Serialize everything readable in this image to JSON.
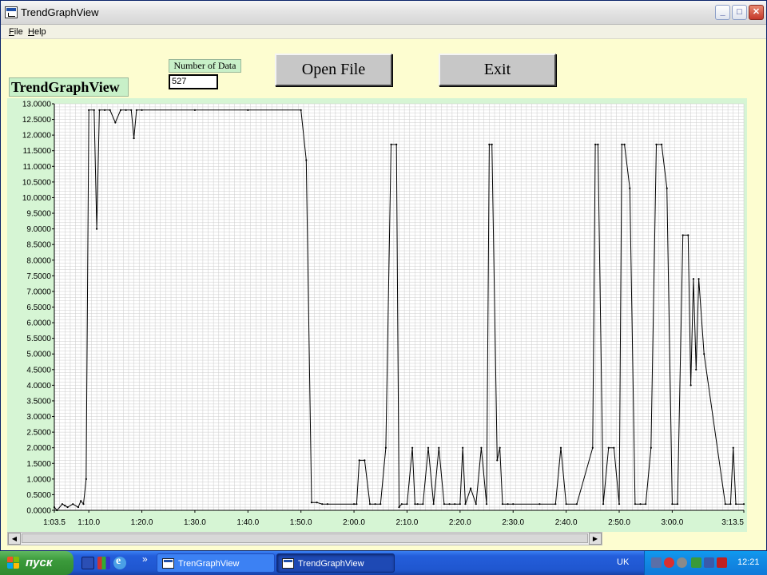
{
  "window": {
    "title": "TrendGraphView"
  },
  "menu": {
    "file": "File",
    "help": "Help"
  },
  "controls": {
    "number_of_data_label": "Number of Data",
    "number_of_data_value": "527",
    "open_file_label": "Open File",
    "exit_label": "Exit"
  },
  "chart_title": "TrendGraphView",
  "chart_data": {
    "type": "line",
    "title": "TrendGraphView",
    "xlabel": "",
    "ylabel": "",
    "ylim": [
      0,
      13
    ],
    "xlim": [
      "1:03.5",
      "3:13.5"
    ],
    "x_ticks": [
      "1:03.5",
      "1:10.0",
      "1:20.0",
      "1:30.0",
      "1:40.0",
      "1:50.0",
      "2:00.0",
      "2:10.0",
      "2:20.0",
      "2:30.0",
      "2:40.0",
      "2:50.0",
      "3:00.0",
      "3:13.5"
    ],
    "y_ticks": [
      "0.0000",
      "0.5000",
      "1.0000",
      "1.5000",
      "2.0000",
      "2.5000",
      "3.0000",
      "3.5000",
      "4.0000",
      "4.5000",
      "5.0000",
      "5.5000",
      "6.0000",
      "6.5000",
      "7.0000",
      "7.5000",
      "8.0000",
      "8.5000",
      "9.0000",
      "9.5000",
      "10.0000",
      "10.5000",
      "11.0000",
      "11.5000",
      "12.0000",
      "12.5000",
      "13.0000"
    ],
    "grid": true,
    "series": [
      {
        "x": [
          "1:03.5",
          "1:04.0",
          "1:05.0",
          "1:05.5",
          "1:06.0",
          "1:07.0",
          "1:08.0",
          "1:08.5",
          "1:09.0",
          "1:09.5",
          "1:10.0",
          "1:11.0",
          "1:11.5",
          "1:12.0",
          "1:13.0",
          "1:14.0",
          "1:15.0",
          "1:16.0",
          "1:17.0",
          "1:18.0",
          "1:18.5",
          "1:19.0",
          "1:20.0",
          "1:30.0",
          "1:40.0",
          "1:50.0",
          "1:51.0",
          "1:52.0",
          "1:53.0",
          "1:54.0",
          "1:55.0",
          "2:00.0",
          "2:00.5",
          "2:01.0",
          "2:02.0",
          "2:03.0",
          "2:04.0",
          "2:05.0",
          "2:06.0",
          "2:07.0",
          "2:08.0",
          "2:08.5",
          "2:09.0",
          "2:10.0",
          "2:11.0",
          "2:11.5",
          "2:12.0",
          "2:13.0",
          "2:14.0",
          "2:15.0",
          "2:16.0",
          "2:17.0",
          "2:18.0",
          "2:19.0",
          "2:20.0",
          "2:20.5",
          "2:21.0",
          "2:22.0",
          "2:23.0",
          "2:24.0",
          "2:25.0",
          "2:25.5",
          "2:26.0",
          "2:27.0",
          "2:27.5",
          "2:28.0",
          "2:29.0",
          "2:30.0",
          "2:35.0",
          "2:38.0",
          "2:39.0",
          "2:40.0",
          "2:42.0",
          "2:45.0",
          "2:45.5",
          "2:46.0",
          "2:47.0",
          "2:48.0",
          "2:49.0",
          "2:50.0",
          "2:50.5",
          "2:51.0",
          "2:52.0",
          "2:53.0",
          "2:54.0",
          "2:55.0",
          "2:56.0",
          "2:57.0",
          "2:58.0",
          "2:59.0",
          "3:00.0",
          "3:01.0",
          "3:02.0",
          "3:03.0",
          "3:03.5",
          "3:04.0",
          "3:04.5",
          "3:05.0",
          "3:06.0",
          "3:10.0",
          "3:11.0",
          "3:11.5",
          "3:12.0",
          "3:13.5"
        ],
        "values": [
          0.1,
          0.0,
          0.2,
          0.15,
          0.1,
          0.2,
          0.1,
          0.3,
          0.2,
          1.0,
          12.8,
          12.8,
          9.0,
          12.8,
          12.8,
          12.8,
          12.4,
          12.8,
          12.8,
          12.8,
          11.9,
          12.8,
          12.8,
          12.8,
          12.8,
          12.8,
          11.2,
          0.25,
          0.25,
          0.2,
          0.2,
          0.2,
          0.2,
          1.6,
          1.6,
          0.2,
          0.2,
          0.2,
          2.0,
          11.7,
          11.7,
          0.1,
          0.2,
          0.2,
          2.0,
          0.2,
          0.2,
          0.2,
          2.0,
          0.2,
          2.0,
          0.2,
          0.2,
          0.2,
          0.2,
          2.0,
          0.2,
          0.7,
          0.2,
          2.0,
          0.2,
          11.7,
          11.7,
          1.6,
          2.0,
          0.2,
          0.2,
          0.2,
          0.2,
          0.2,
          2.0,
          0.2,
          0.2,
          2.0,
          11.7,
          11.7,
          0.2,
          2.0,
          2.0,
          0.2,
          11.7,
          11.7,
          10.3,
          0.2,
          0.2,
          0.2,
          2.0,
          11.7,
          11.7,
          10.3,
          0.2,
          0.2,
          8.8,
          8.8,
          4.0,
          7.4,
          4.5,
          7.4,
          5.0,
          0.2,
          0.2,
          2.0,
          0.2,
          0.2
        ]
      }
    ]
  },
  "taskbar": {
    "start_label": "пуск",
    "quicklaunch_more": "»",
    "tasks": [
      {
        "label": "TrenGraphView"
      },
      {
        "label": "TrendGraphView"
      }
    ],
    "language": "UK",
    "clock": "12:21"
  }
}
